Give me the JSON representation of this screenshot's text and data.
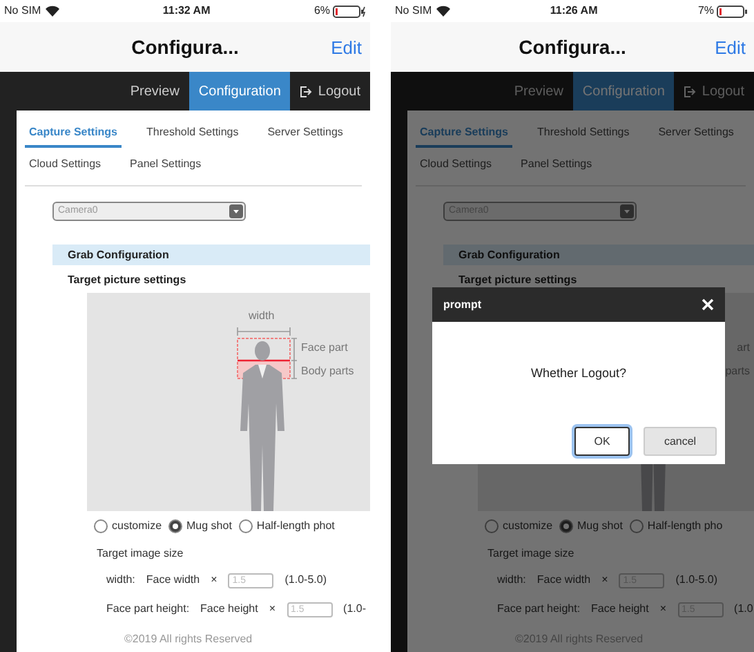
{
  "screens": [
    {
      "status": {
        "carrier": "No SIM",
        "time": "11:32 AM",
        "battery": "6%",
        "charging": true
      },
      "title": "Configura...",
      "edit": "Edit",
      "nav": [
        {
          "label": "Preview",
          "selected": false,
          "kind": "plain"
        },
        {
          "label": "Configuration",
          "selected": true,
          "kind": "plain"
        },
        {
          "label": "Logout",
          "selected": false,
          "kind": "logout"
        }
      ],
      "tabs": [
        {
          "label": "Capture Settings",
          "selected": true
        },
        {
          "label": "Threshold Settings",
          "selected": false
        },
        {
          "label": "Server Settings",
          "selected": false
        },
        {
          "label": "Cloud Settings",
          "selected": false
        },
        {
          "label": "Panel Settings",
          "selected": false
        }
      ],
      "camera": "Camera0",
      "section": "Grab Configuration",
      "subheading": "Target picture settings",
      "figure": {
        "width_label": "width",
        "labels": [
          "Face part",
          "Body parts"
        ]
      },
      "radios": [
        {
          "label": "customize",
          "selected": false
        },
        {
          "label": "Mug shot",
          "selected": true
        },
        {
          "label": "Half-length phot",
          "selected": false
        }
      ],
      "size_heading": "Target image size",
      "rows": [
        {
          "label": "width:",
          "factor": "Face width",
          "times": "×",
          "value": "1.5",
          "range": "(1.0-5.0)"
        },
        {
          "label": "Face part height:",
          "factor": "Face height",
          "times": "×",
          "value": "1.5",
          "range": "(1.0-"
        }
      ],
      "footer": "©2019 All rights Reserved"
    },
    {
      "status": {
        "carrier": "No SIM",
        "time": "11:26 AM",
        "battery": "7%",
        "charging": false
      },
      "title": "Configura...",
      "edit": "Edit",
      "nav": [
        {
          "label": "Preview",
          "selected": false,
          "kind": "plain"
        },
        {
          "label": "Configuration",
          "selected": true,
          "kind": "plain"
        },
        {
          "label": "Logout",
          "selected": false,
          "kind": "logout"
        }
      ],
      "tabs": [
        {
          "label": "Capture Settings",
          "selected": true
        },
        {
          "label": "Threshold Settings",
          "selected": false
        },
        {
          "label": "Server Settings",
          "selected": false
        },
        {
          "label": "Cloud Settings",
          "selected": false
        },
        {
          "label": "Panel Settings",
          "selected": false
        }
      ],
      "camera": "Camera0",
      "section": "Grab Configuration",
      "subheading": "Target picture settings",
      "figure": {
        "labels": [
          "art",
          "parts"
        ]
      },
      "radios": [
        {
          "label": "customize",
          "selected": false
        },
        {
          "label": "Mug shot",
          "selected": true
        },
        {
          "label": "Half-length pho",
          "selected": false
        }
      ],
      "size_heading": "Target image size",
      "rows": [
        {
          "label": "width:",
          "factor": "Face width",
          "times": "×",
          "value": "1.5",
          "range": "(1.0-5.0)"
        },
        {
          "label": "Face part height:",
          "factor": "Face height",
          "times": "×",
          "value": "1.5",
          "range": "(1.0"
        }
      ],
      "footer": "©2019 All rights Reserved",
      "dialog": {
        "title": "prompt",
        "message": "Whether Logout?",
        "buttons": [
          {
            "label": "OK",
            "selected": true
          },
          {
            "label": "cancel",
            "selected": false
          }
        ]
      }
    }
  ]
}
